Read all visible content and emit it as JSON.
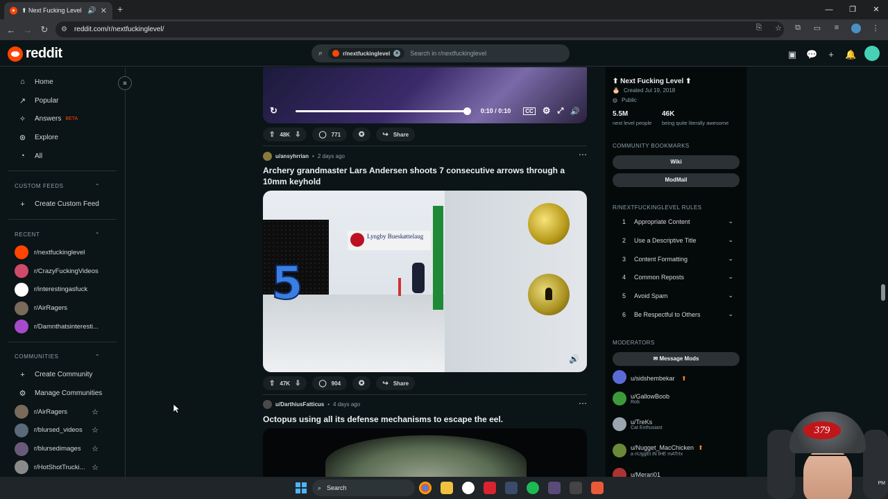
{
  "browser": {
    "tab_title": "⬆ Next Fucking Level ⬆",
    "url": "reddit.com/r/nextfuckinglevel/"
  },
  "header": {
    "logo_text": "reddit",
    "search_chip": "r/nextfuckinglevel",
    "search_placeholder": "Search in r/nextfuckinglevel"
  },
  "sidebar": {
    "nav": [
      {
        "label": "Home",
        "icon": "home-icon"
      },
      {
        "label": "Popular",
        "icon": "popular-icon"
      },
      {
        "label": "Answers",
        "icon": "answers-icon",
        "badge": "BETA"
      },
      {
        "label": "Explore",
        "icon": "explore-icon"
      },
      {
        "label": "All",
        "icon": "all-icon"
      }
    ],
    "custom_feeds_header": "CUSTOM FEEDS",
    "create_custom_feed": "Create Custom Feed",
    "recent_header": "RECENT",
    "recent": [
      {
        "label": "r/nextfuckinglevel",
        "color": "#ff4500"
      },
      {
        "label": "r/CrazyFuckingVideos",
        "color": "#d04a6a"
      },
      {
        "label": "r/interestingasfuck",
        "color": "#ffffff"
      },
      {
        "label": "r/AirRagers",
        "color": "#7a6a5a"
      },
      {
        "label": "r/Damnthatsinteresti...",
        "color": "#a64ac9"
      }
    ],
    "communities_header": "COMMUNITIES",
    "create_community": "Create Community",
    "manage_communities": "Manage Communities",
    "communities": [
      {
        "label": "r/AirRagers",
        "color": "#7a6a5a"
      },
      {
        "label": "r/blursed_videos",
        "color": "#5a6a7a"
      },
      {
        "label": "r/blursedimages",
        "color": "#6a5a7a"
      },
      {
        "label": "r/HotShotTrucki...",
        "color": "#8a8a8a"
      }
    ]
  },
  "feed": {
    "video": {
      "time": "0:10 / 0:10",
      "progress": 1.0
    },
    "post0": {
      "upvotes": "48K",
      "comments": "771",
      "share": "Share"
    },
    "post1": {
      "user": "u/ansyhrrian",
      "age": "2 days ago",
      "title": "Archery grandmaster Lars Andersen shoots 7 consecutive arrows through a 10mm keyhold",
      "image_sign": "Lyngby Bueskøttelaug",
      "image_number": "5",
      "upvotes": "47K",
      "comments": "904",
      "share": "Share"
    },
    "post2": {
      "user": "u/DarthiusFatticus",
      "age": "4 days ago",
      "title": "Octopus using all its defense mechanisms to escape the eel."
    },
    "separator": "•"
  },
  "right_sidebar": {
    "title": "⬆ Next Fucking Level ⬆",
    "created": "Created Jul 19, 2018",
    "visibility": "Public",
    "members": "5.5M",
    "members_label": "next level people",
    "online": "46K",
    "online_label": "being quite literally awesome",
    "bookmarks_header": "COMMUNITY BOOKMARKS",
    "bookmarks": [
      "Wiki",
      "ModMail"
    ],
    "rules_header": "R/NEXTFUCKINGLEVEL RULES",
    "rules": [
      {
        "n": "1",
        "label": "Appropriate Content"
      },
      {
        "n": "2",
        "label": "Use a Descriptive Title"
      },
      {
        "n": "3",
        "label": "Content Formatting"
      },
      {
        "n": "4",
        "label": "Common Reposts"
      },
      {
        "n": "5",
        "label": "Avoid Spam"
      },
      {
        "n": "6",
        "label": "Be Respectful to Others"
      }
    ],
    "moderators_header": "MODERATORS",
    "message_mods": "Message Mods",
    "moderators": [
      {
        "name": "u/sidshembekar",
        "flair": "",
        "color": "#5b6bd6"
      },
      {
        "name": "u/GallowBoob",
        "flair": "Rob",
        "color": "#3c9a3a"
      },
      {
        "name": "u/TreKs",
        "flair": "Cat Enthusiast",
        "color": "#9aa5b0"
      },
      {
        "name": "u/Nugget_MacChicken",
        "flair": "a nUggEt iN tHE mATrIx",
        "color": "#6a8a3a"
      },
      {
        "name": "u/Merari01",
        "flair": "",
        "color": "#a33"
      }
    ]
  },
  "taskbar": {
    "search": "Search"
  },
  "webcam": {
    "hat_text": "379",
    "clock": "PM"
  }
}
